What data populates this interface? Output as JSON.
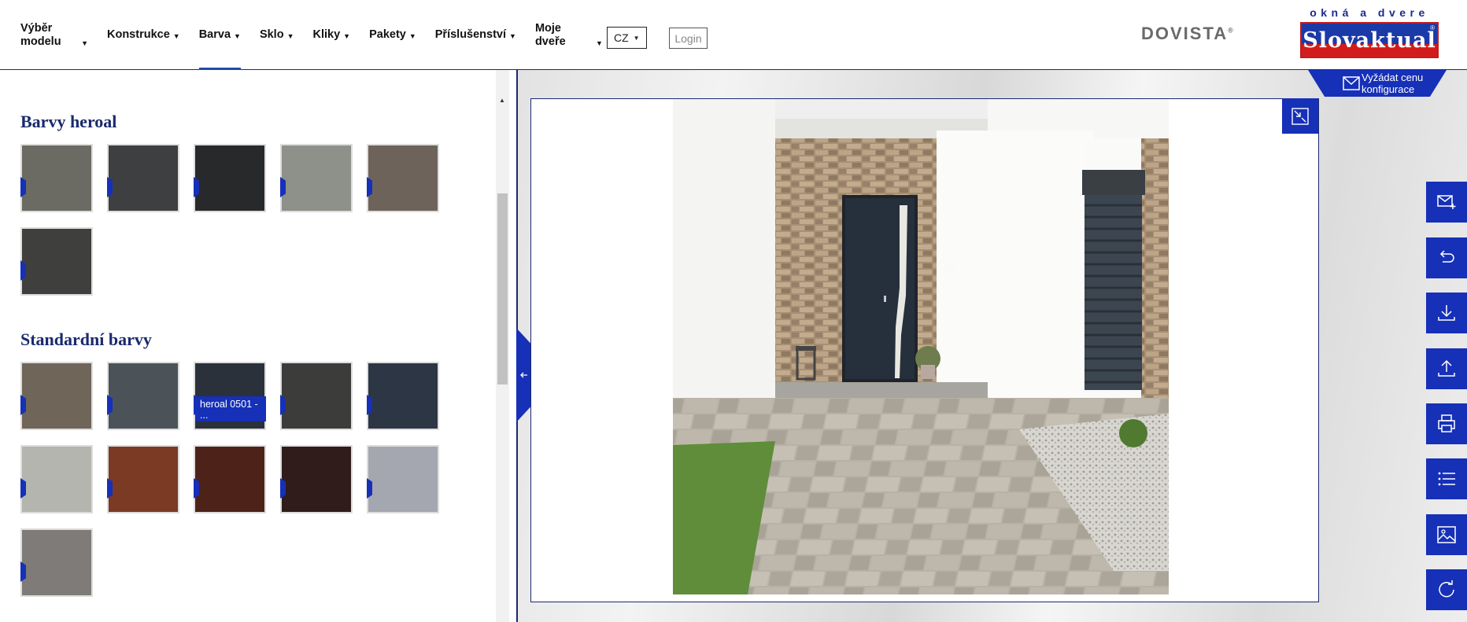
{
  "nav": {
    "items": [
      {
        "label": "Výběr\nmodelu",
        "two_line": true
      },
      {
        "label": "Konstrukce"
      },
      {
        "label": "Barva",
        "active": true
      },
      {
        "label": "Sklo"
      },
      {
        "label": "Kliky"
      },
      {
        "label": "Pakety"
      },
      {
        "label": "Příslušenství"
      },
      {
        "label": "Moje\ndveře",
        "two_line": true
      }
    ],
    "caret": "▼"
  },
  "language": {
    "selected": "CZ",
    "caret": "▼"
  },
  "login": {
    "label": "Login"
  },
  "brand": {
    "dovista": "DOVISTA",
    "dovista_mark": "®",
    "tagline": "okná a dvere",
    "name": "Slovaktual",
    "name_mark": "®"
  },
  "sections": {
    "heroal": {
      "title": "Barvy heroal",
      "swatches": [
        {
          "color": "#6b6b63"
        },
        {
          "color": "#3d3f40"
        },
        {
          "color": "#28292a"
        },
        {
          "color": "#8e908a"
        },
        {
          "color": "#6d635a"
        },
        {
          "color": "#3f3f3d"
        }
      ]
    },
    "standard": {
      "title": "Standardní barvy",
      "swatches": [
        {
          "color": "#6f6558"
        },
        {
          "color": "#4b5358"
        },
        {
          "color": "#2a313b",
          "tooltip": "heroal 0501 - ..."
        },
        {
          "color": "#3c3d3a"
        },
        {
          "color": "#2d3645"
        },
        {
          "color": "#b3b5ae"
        },
        {
          "color": "#7a3a24"
        },
        {
          "color": "#4d2319"
        },
        {
          "color": "#301c1b"
        },
        {
          "color": "#a4a7b0"
        },
        {
          "color": "#7e7b78"
        }
      ]
    }
  },
  "request_price": {
    "label": "Vyžádat cenu\nkonfigurace"
  },
  "colors": {
    "accent": "#1630b8",
    "navy": "#1a2a6e",
    "door": "#26303c"
  },
  "side_toolbar": [
    {
      "name": "email-add-icon"
    },
    {
      "name": "undo-icon"
    },
    {
      "name": "download-icon"
    },
    {
      "name": "upload-icon"
    },
    {
      "name": "print-icon"
    },
    {
      "name": "list-icon"
    },
    {
      "name": "image-icon"
    },
    {
      "name": "refresh-icon"
    }
  ]
}
